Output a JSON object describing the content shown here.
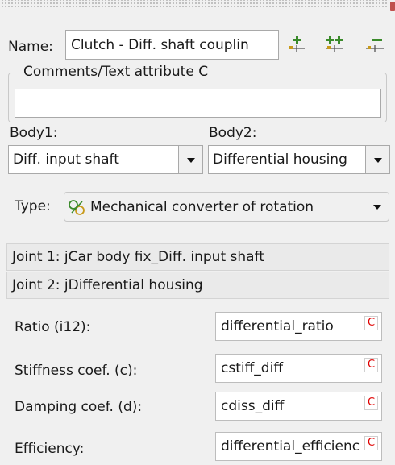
{
  "name": {
    "label": "Name:",
    "value": "Clutch - Diff. shaft couplin"
  },
  "toolbar": {
    "icons": [
      "add-marker-icon",
      "add-double-marker-icon",
      "remove-marker-icon"
    ]
  },
  "comments": {
    "legend": "Comments/Text attribute C",
    "value": ""
  },
  "bodies": {
    "body1_label": "Body1:",
    "body1_value": "Diff. input shaft",
    "body2_label": "Body2:",
    "body2_value": "Differential housing"
  },
  "type": {
    "label": "Type:",
    "value": "Mechanical converter of rotation",
    "icon": "rotation-converter-icon"
  },
  "joints": [
    {
      "label": "Joint 1: jCar body fix_Diff. input shaft"
    },
    {
      "label": "Joint 2: jDifferential housing"
    }
  ],
  "params": [
    {
      "label": "Ratio (i12):",
      "value": "differential_ratio",
      "badge": "C"
    },
    {
      "label": "Stiffness coef. (c):",
      "value": "cstiff_diff",
      "badge": "C"
    },
    {
      "label": "Damping coef. (d):",
      "value": "cdiss_diff",
      "badge": "C"
    },
    {
      "label": "Efficiency:",
      "value": "differential_efficienc",
      "badge": "C"
    }
  ],
  "colors": {
    "badge_text": "#e00000",
    "icon_green": "#3a8a2a",
    "icon_gold": "#c89a1a"
  }
}
